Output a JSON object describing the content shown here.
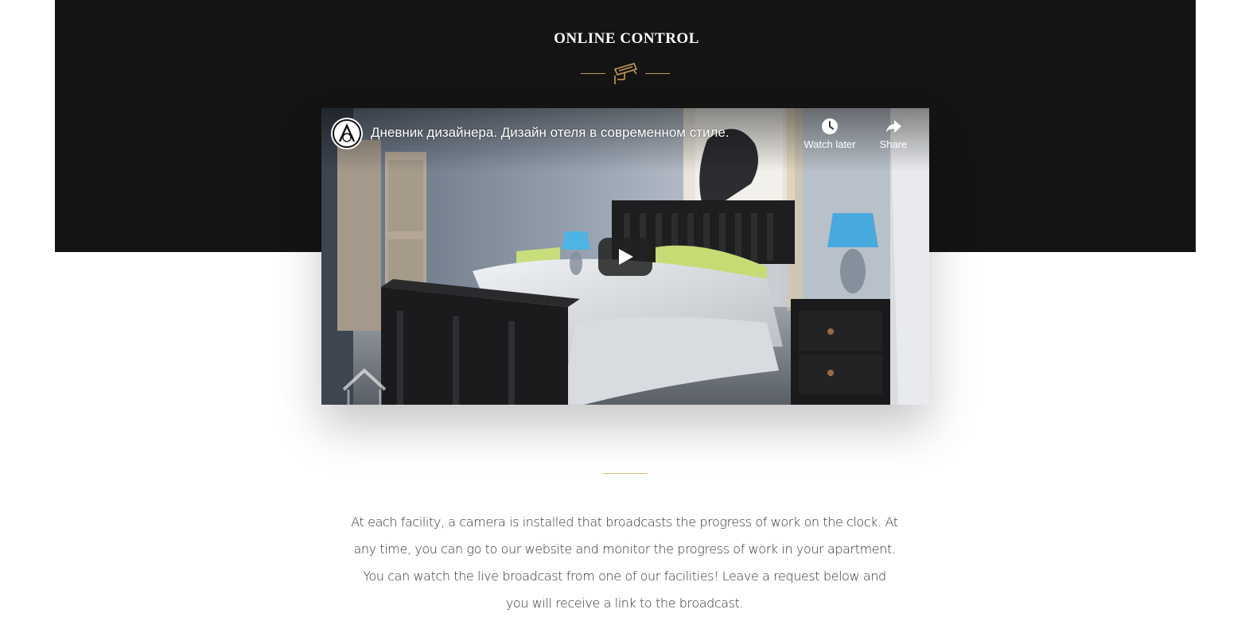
{
  "section": {
    "title": "ONLINE CONTROL",
    "accent_color": "#c49a58",
    "ornament_icon": "cctv-camera-icon"
  },
  "video": {
    "title": "Дневник дизайнера. Дизайн отеля в современном стиле.",
    "channel_logo_icon": "channel-logo-icon",
    "watch_later_label": "Watch later",
    "watch_later_icon": "clock-icon",
    "share_label": "Share",
    "share_icon": "share-arrow-icon",
    "play_icon": "play-icon"
  },
  "description": {
    "text": "At each facility, a camera is installed that broadcasts the progress of work on the clock. At any time, you can go to our website and monitor the progress of work in your apartment. You can watch the live broadcast from one of our facilities! Leave a request below and you will receive a link to the broadcast."
  }
}
